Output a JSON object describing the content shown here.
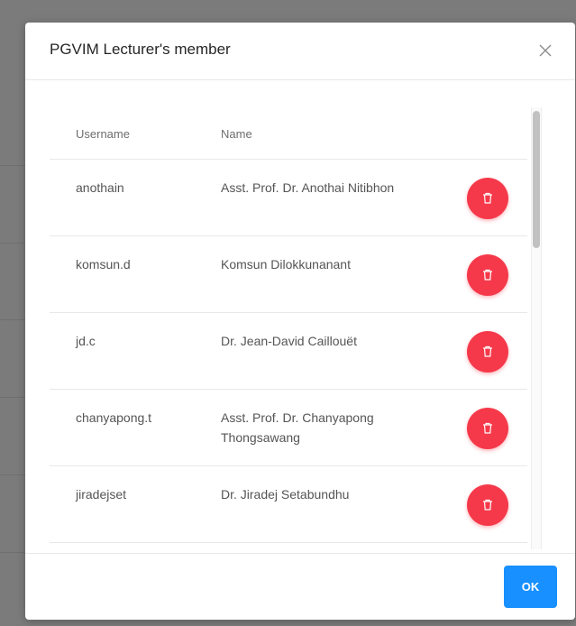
{
  "modal": {
    "title": "PGVIM Lecturer's member",
    "close_icon": "close-icon",
    "ok_label": "OK"
  },
  "table": {
    "headers": {
      "username": "Username",
      "name": "Name"
    },
    "rows": [
      {
        "username": "anothain",
        "name": "Asst. Prof. Dr. Anothai Nitibhon"
      },
      {
        "username": "komsun.d",
        "name": "Komsun Dilokkunanant"
      },
      {
        "username": "jd.c",
        "name": "Dr. Jean-David Caillouët"
      },
      {
        "username": "chanyapong.t",
        "name": "Asst. Prof. Dr. Chanyapong Thongsawang"
      },
      {
        "username": "jiradejset",
        "name": "Dr. Jiradej Setabundhu"
      }
    ],
    "delete_icon": "trash-icon"
  },
  "colors": {
    "overlay": "#7b7b7b",
    "delete_button": "#f5394a",
    "ok_button": "#1890ff"
  }
}
